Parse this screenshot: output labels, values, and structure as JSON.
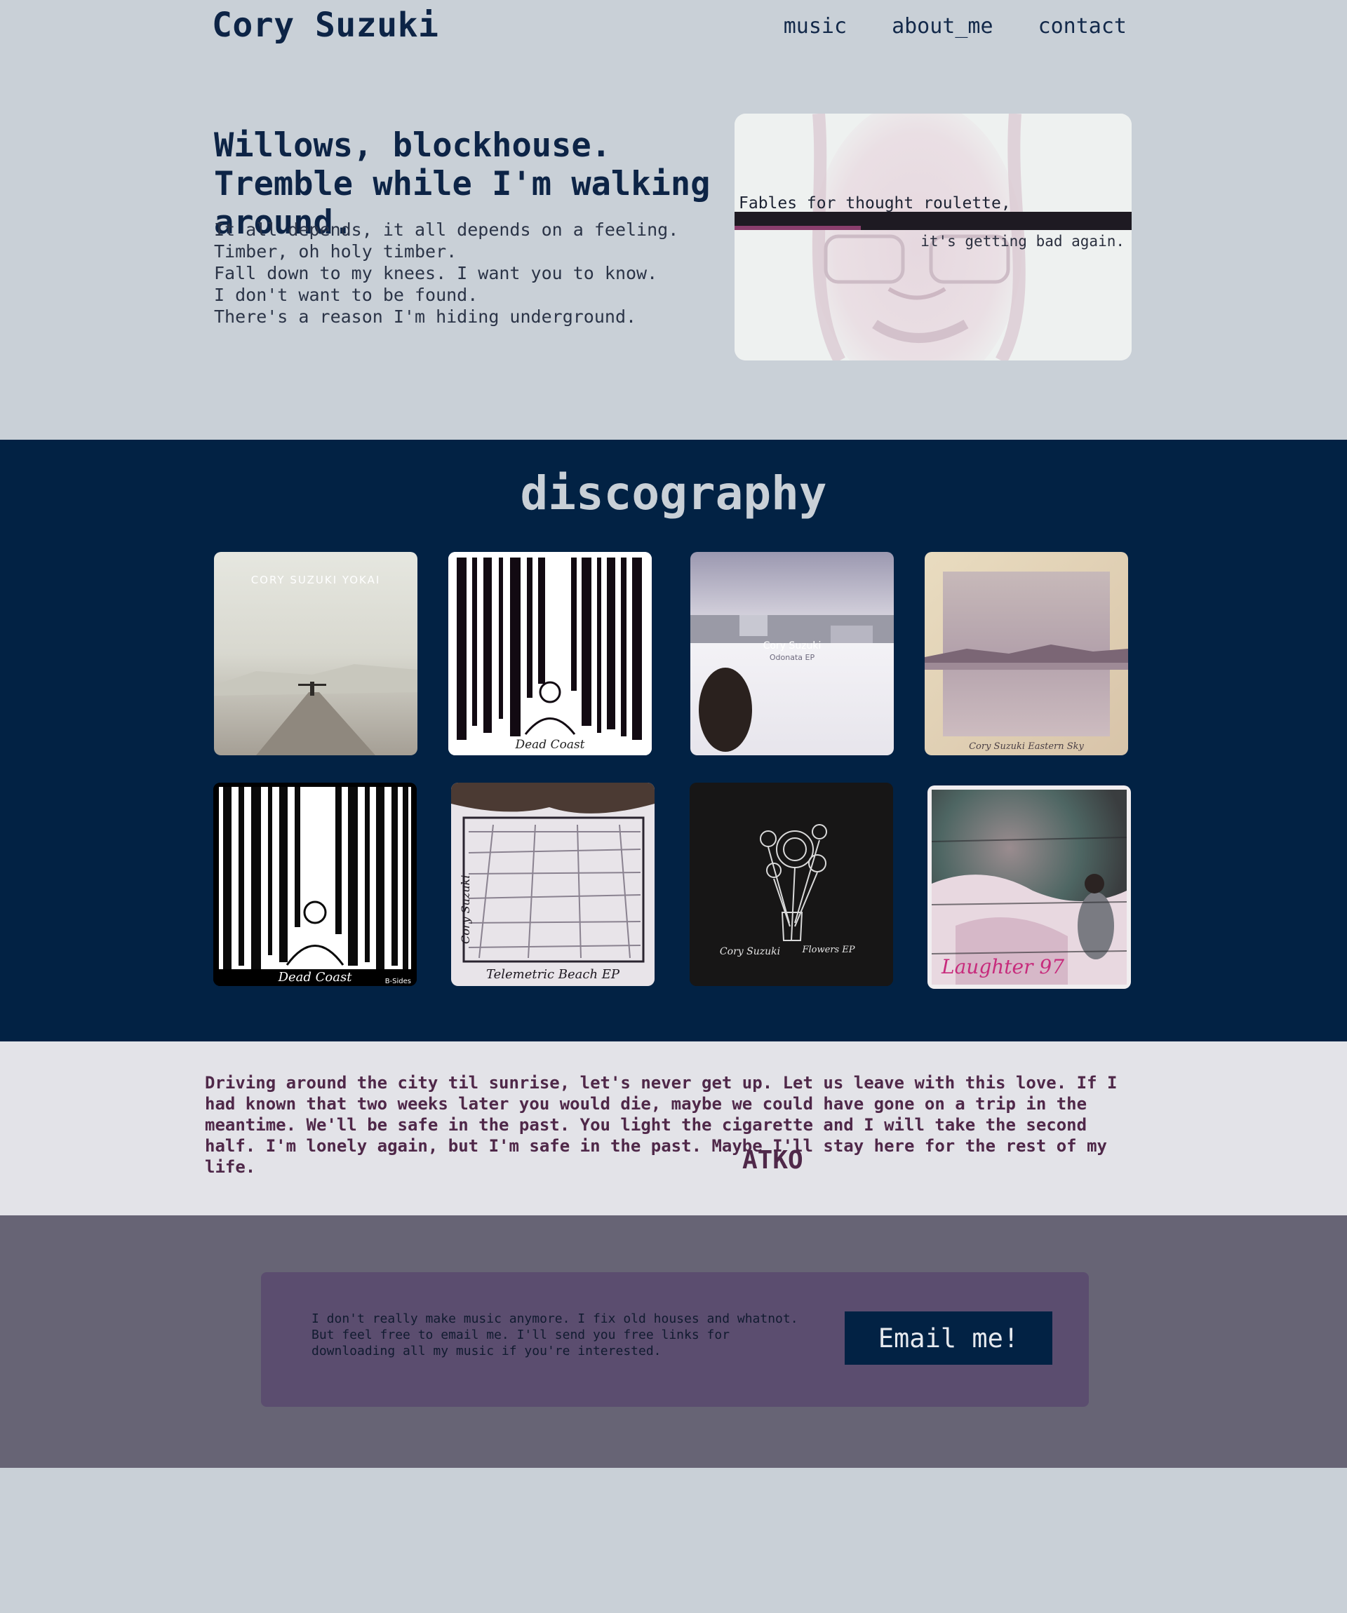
{
  "header": {
    "title": "Cory Suzuki",
    "nav": [
      "music",
      "about_me",
      "contact"
    ]
  },
  "hero": {
    "heading": "Willows, blockhouse. Tremble while I'm walking around.",
    "lyrics": [
      "It all depends, it all depends on a feeling.",
      "Timber, oh holy timber.",
      "Fall down to my knees. I want you to know.",
      "I don't want to be found.",
      "There's a reason I'm hiding underground."
    ],
    "photo_caption_1": "Fables for thought roulette,",
    "photo_caption_2": "it's getting bad again."
  },
  "discography": {
    "title": "discography",
    "albums": [
      {
        "cover_text": [
          "CORY SUZUKI YOKAI"
        ]
      },
      {
        "cover_text": [
          "Dead Coast"
        ]
      },
      {
        "cover_text": [
          "Cory Suzuki",
          "Odonata EP"
        ]
      },
      {
        "cover_text": [
          "Cory Suzuki  Eastern Sky"
        ]
      },
      {
        "cover_text": [
          "Dead Coast",
          "B-Sides"
        ]
      },
      {
        "cover_text": [
          "Cory Suzuki",
          "Telemetric Beach EP"
        ]
      },
      {
        "cover_text": [
          "Cory Suzuki",
          "Flowers EP"
        ]
      },
      {
        "cover_text": [
          "Laughter 97"
        ]
      }
    ]
  },
  "quote": {
    "text": "Driving around the city til sunrise, let's never get up. Let us leave with this love. If I had known that two weeks later you would die, maybe we could have gone on a trip in the meantime. We'll be safe in the past. You light the cigarette and I will take the second half. I'm lonely again, but I'm safe in the past. Maybe I'll stay here for the rest of my life.",
    "attribution": "ATKO"
  },
  "contact": {
    "text": "I don't really make music anymore. I fix old houses and whatnot. But feel free to email me. I'll send you free links for downloading all my music if you're interested.",
    "button": "Email me!"
  },
  "colors": {
    "page_bg": "#c9d0d7",
    "navy": "#022244",
    "quote_bg": "#e3e3e8",
    "quote_text": "#4f2849",
    "contact_bg": "#676475",
    "contact_card": "#5b4d6f"
  }
}
